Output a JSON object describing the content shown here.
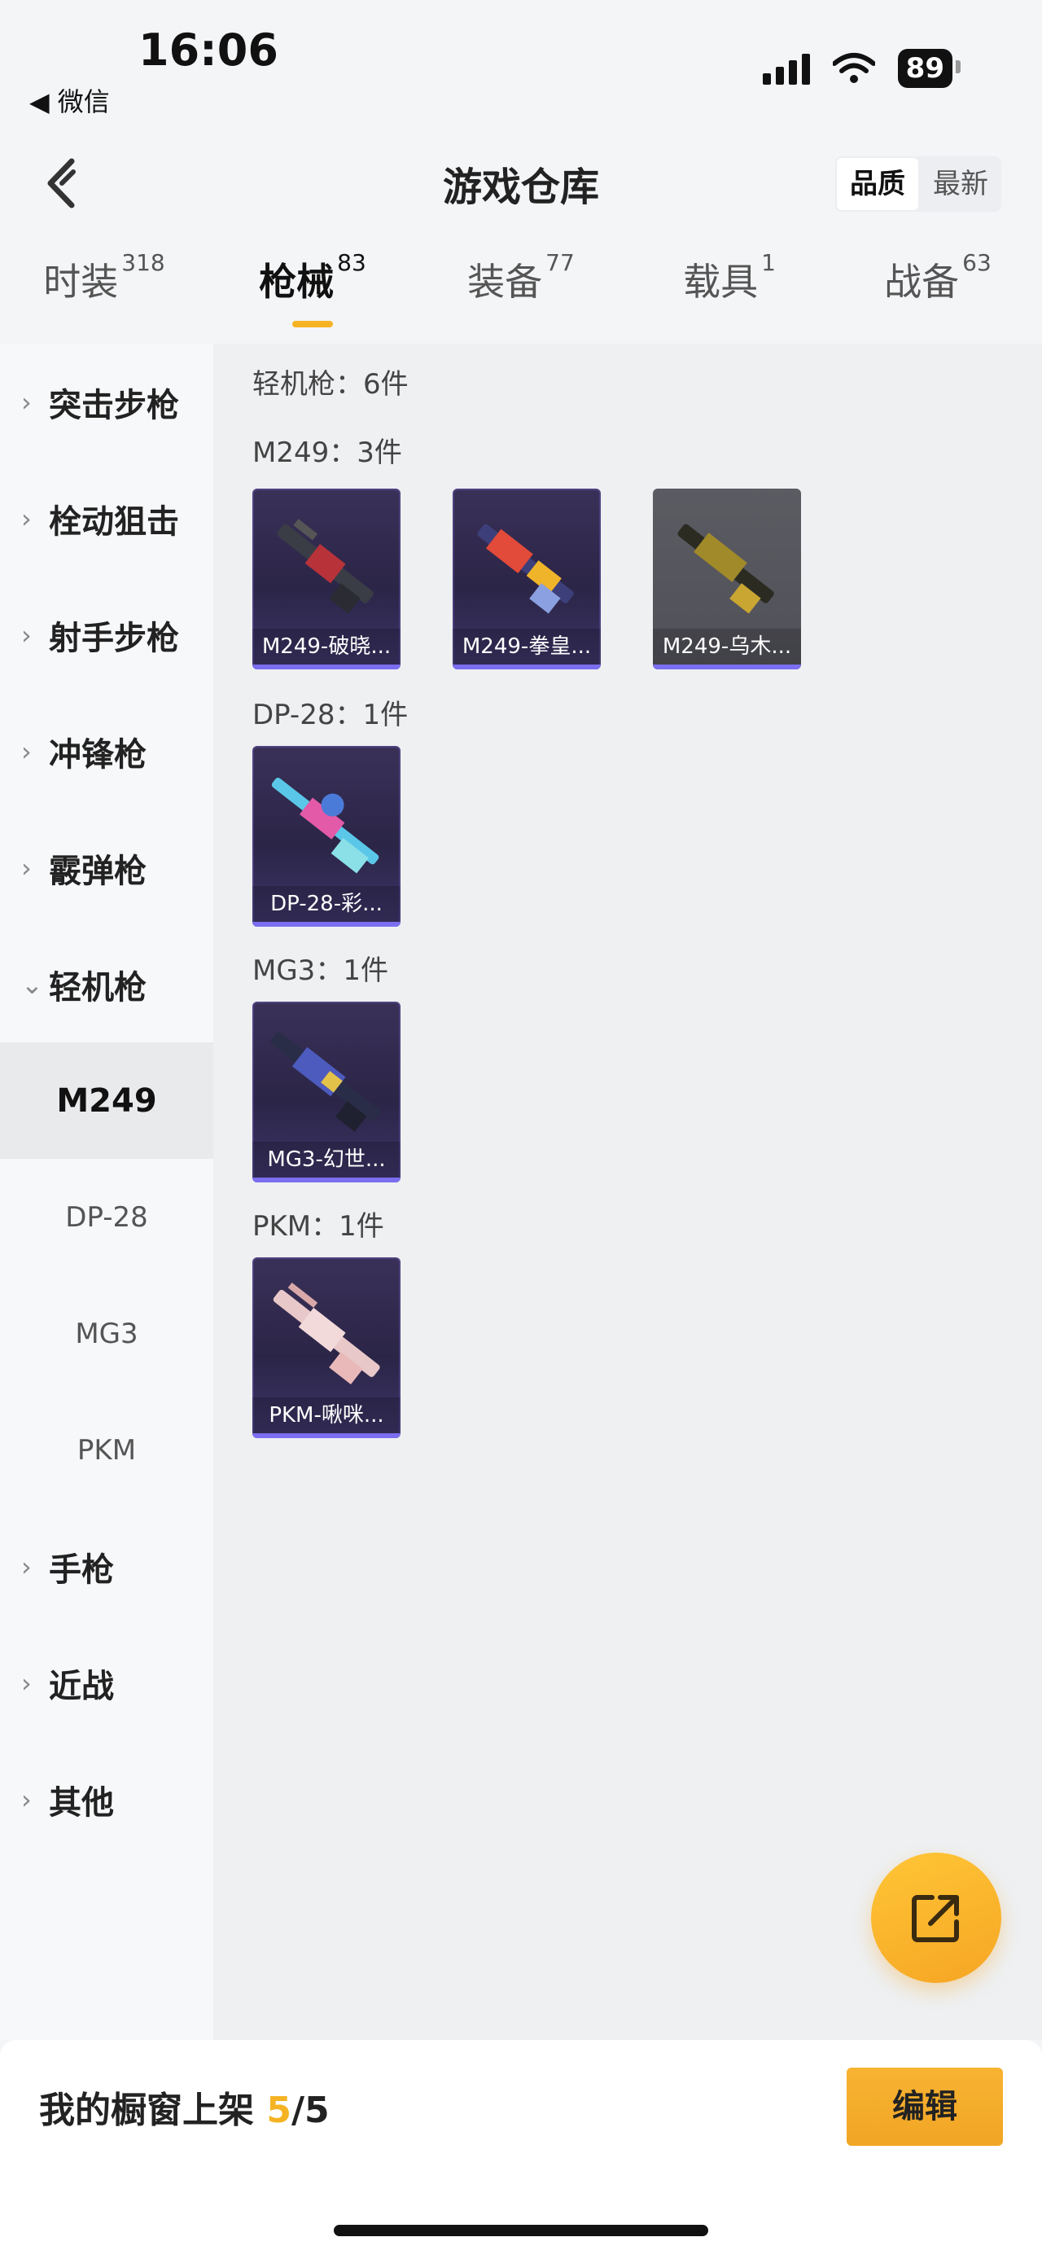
{
  "status_bar": {
    "time": "16:06",
    "back_label": "◀ 微信",
    "battery": "89"
  },
  "header": {
    "title": "游戏仓库",
    "sort_quality": "品质",
    "sort_newest": "最新"
  },
  "tabs": [
    {
      "label": "时装",
      "count": "318"
    },
    {
      "label": "枪械",
      "count": "83"
    },
    {
      "label": "装备",
      "count": "77"
    },
    {
      "label": "载具",
      "count": "1"
    },
    {
      "label": "战备",
      "count": "63"
    }
  ],
  "sidebar": {
    "categories_top": [
      "突击步枪",
      "栓动狙击",
      "射手步枪",
      "冲锋枪",
      "霰弹枪",
      "轻机枪"
    ],
    "subitems": [
      "M249",
      "DP-28",
      "MG3",
      "PKM"
    ],
    "categories_bottom": [
      "手枪",
      "近战",
      "其他"
    ]
  },
  "content": {
    "summary": "轻机枪：6件",
    "sections": [
      {
        "title": "M249：3件",
        "items": [
          "M249-破晓...",
          "M249-拳皇...",
          "M249-乌木..."
        ]
      },
      {
        "title": "DP-28：1件",
        "items": [
          "DP-28-彩..."
        ]
      },
      {
        "title": "MG3：1件",
        "items": [
          "MG3-幻世..."
        ]
      },
      {
        "title": "PKM：1件",
        "items": [
          "PKM-啾咪..."
        ]
      }
    ]
  },
  "bottom": {
    "shelf_label": "我的橱窗上架 ",
    "shelf_count": "5",
    "shelf_total": "/5",
    "edit_label": "编辑"
  },
  "colors": {
    "accent": "#f5b323",
    "card_purple": "#2b2547",
    "card_gray": "#55555c"
  }
}
